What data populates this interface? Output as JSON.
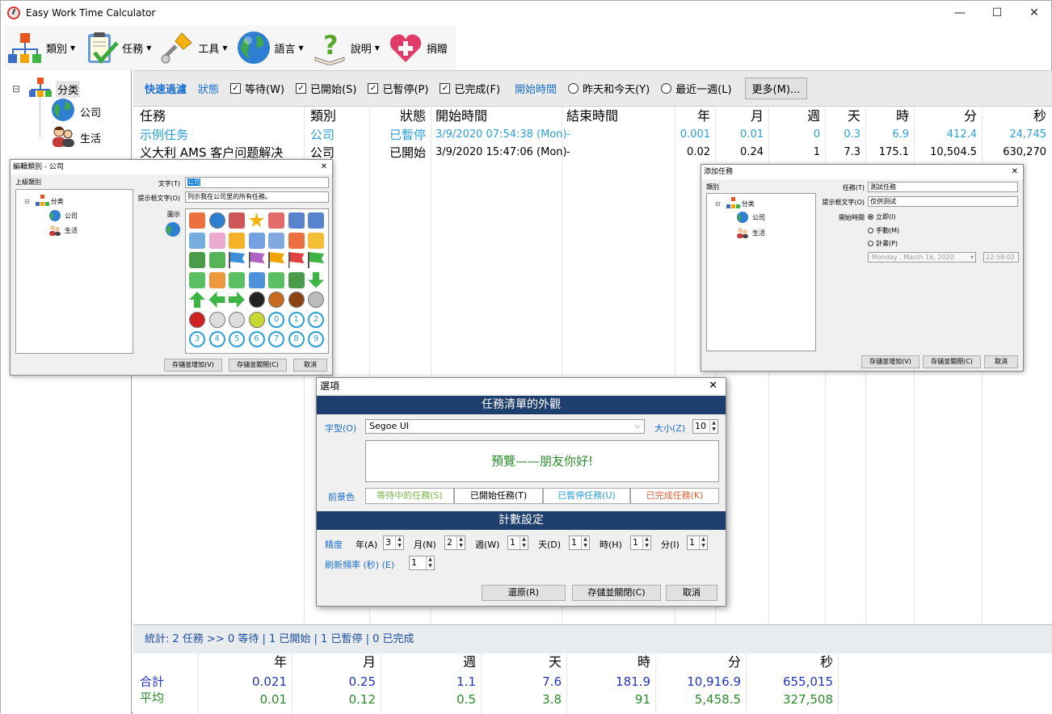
{
  "app": {
    "title": "Easy Work Time Calculator",
    "win_min": "—",
    "win_max": "☐",
    "win_close": "✕"
  },
  "toolbar": [
    {
      "label": "類別",
      "icon": "category-hierarchy-icon"
    },
    {
      "label": "任務",
      "icon": "task-clipboard-icon"
    },
    {
      "label": "工具",
      "icon": "tools-screwdriver-icon"
    },
    {
      "label": "語言",
      "icon": "globe-icon"
    },
    {
      "label": "說明",
      "icon": "help-question-icon"
    },
    {
      "label": "捐贈",
      "icon": "donate-heart-icon"
    }
  ],
  "tree": {
    "root": "分类",
    "children": [
      "公司",
      "生活"
    ],
    "expander": "⊟"
  },
  "filter": {
    "quick_filter": "快速過濾",
    "status_label": "狀態",
    "checks": [
      {
        "label": "等待(W)",
        "checked": true
      },
      {
        "label": "已開始(S)",
        "checked": true
      },
      {
        "label": "已暫停(P)",
        "checked": true
      },
      {
        "label": "已完成(F)",
        "checked": true
      }
    ],
    "start_time_label": "開始時間",
    "radios": [
      {
        "label": "昨天和今天(Y)"
      },
      {
        "label": "最近一週(L)"
      }
    ],
    "more_button": "更多(M)..."
  },
  "grid": {
    "headers": [
      "任務",
      "類別",
      "狀態",
      "開始時間",
      "結束時間",
      "年",
      "月",
      "週",
      "天",
      "時",
      "分",
      "秒"
    ],
    "rows": [
      {
        "task": "示例任务",
        "category": "公司",
        "status": "已暫停",
        "start": "3/9/2020 07:54:38 (Mon)",
        "end": "-",
        "year": "0.001",
        "month": "0.01",
        "week": "0",
        "day": "0.3",
        "hour": "6.9",
        "minute": "412.4",
        "second": "24,745",
        "color": "#2a9fd6"
      },
      {
        "task": "义大利 AMS 客户问题解决",
        "category": "公司",
        "status": "已開始",
        "start": "3/9/2020 15:47:06 (Mon)",
        "end": "-",
        "year": "0.02",
        "month": "0.24",
        "week": "1",
        "day": "7.3",
        "hour": "175.1",
        "minute": "10,504.5",
        "second": "630,270",
        "color": "#000000"
      }
    ]
  },
  "status_bar": {
    "text": "統計: 2 任務 >> 0 等待 | 1 已開始 | 1 已暫停 | 0 已完成"
  },
  "totals": {
    "headers": [
      "年",
      "月",
      "週",
      "天",
      "時",
      "分",
      "秒"
    ],
    "sum_label": "合計",
    "sum": [
      "0.021",
      "0.25",
      "1.1",
      "7.6",
      "181.9",
      "10,916.9",
      "655,015"
    ],
    "avg_label": "平均",
    "avg": [
      "0.01",
      "0.12",
      "0.5",
      "3.8",
      "91",
      "5,458.5",
      "327,508"
    ]
  },
  "edit_category_dialog": {
    "title": "編輯類別 - 公司",
    "parent_label": "上級類別",
    "tree_root": "分类",
    "tree_children": [
      "公司",
      "生活"
    ],
    "text_label": "文字(T)",
    "text_value": "公司",
    "tooltip_label": "提示框文字(O)",
    "tooltip_value": "列示我在公司里的所有任務。",
    "icon_label": "圖示",
    "icon_names": [
      "category-icon",
      "globe-icon",
      "people-icon",
      "star-icon",
      "check-icon",
      "monitor-icon",
      "phone-icon",
      "plane-icon",
      "pig-icon",
      "chat-icon",
      "calendar-icon",
      "notepad-icon",
      "clock-icon",
      "mail-icon",
      "book-icon",
      "chart-icon",
      "flag-blue-icon",
      "flag-purple-icon",
      "flag-orange-icon",
      "flag-red-icon",
      "flag-green-icon",
      "tag-green-icon",
      "tag-orange-icon",
      "music-icon",
      "ticket-icon",
      "info-icon",
      "tree-icon",
      "arrow-down-icon",
      "arrow-up-icon",
      "arrow-left-icon",
      "arrow-right-icon",
      "soccer-icon",
      "basketball-icon",
      "football-icon",
      "volleyball-icon",
      "pingpong-icon",
      "baseball-icon",
      "golf-icon",
      "tennis-icon",
      "num-0-icon",
      "num-1-icon",
      "num-2-icon",
      "num-3-icon",
      "num-4-icon",
      "num-5-icon",
      "num-6-icon",
      "num-7-icon",
      "num-8-icon",
      "num-9-icon"
    ],
    "numbers": [
      "0",
      "1",
      "2",
      "3",
      "4",
      "5",
      "6",
      "7",
      "8",
      "9"
    ],
    "btn_save_add": "存儲並增加(V)",
    "btn_save_close": "存儲並關閉(C)",
    "btn_cancel": "取消"
  },
  "add_task_dialog": {
    "title": "添加任務",
    "category_label": "類別",
    "tree_root": "分类",
    "tree_children": [
      "公司",
      "生活"
    ],
    "task_label": "任務(T)",
    "task_value": "測試任務",
    "tooltip_label": "提示框文字(O)",
    "tooltip_value": "仅供测试",
    "start_label": "開始時間",
    "radios": [
      "立即(I)",
      "手動(M)",
      "計畫(P)"
    ],
    "date_value": "Monday ,  March  16, 2020",
    "time_value": "22:58:02",
    "btn_save_add": "存儲並增加(V)",
    "btn_save_close": "存儲並關閉(C)",
    "btn_cancel": "取消"
  },
  "options_dialog": {
    "title": "選項",
    "section_appearance": "任務清單的外觀",
    "font_label": "字型(O)",
    "font_value": "Segoe UI",
    "size_label": "大小(Z)",
    "size_value": "10",
    "preview_text": "預覽——朋友你好!",
    "fg_label": "前景色",
    "fg_buttons": [
      {
        "label": "等待中的任務(S)",
        "color": "#7ab648"
      },
      {
        "label": "已開始任務(T)",
        "color": "#000000"
      },
      {
        "label": "已暫停任務(U)",
        "color": "#2a9fd6"
      },
      {
        "label": "已完成任務(K)",
        "color": "#e06030"
      }
    ],
    "section_calc": "計數設定",
    "precision_label": "精度",
    "precision": [
      {
        "label": "年(A)",
        "value": "3"
      },
      {
        "label": "月(N)",
        "value": "2"
      },
      {
        "label": "週(W)",
        "value": "1"
      },
      {
        "label": "天(D)",
        "value": "1"
      },
      {
        "label": "時(H)",
        "value": "1"
      },
      {
        "label": "分(I)",
        "value": "1"
      }
    ],
    "refresh_label": "刷新頻率 (秒) (E)",
    "refresh_value": "1",
    "btn_restore": "還原(R)",
    "btn_save_close": "存儲並關閉(C)",
    "btn_cancel": "取消"
  }
}
